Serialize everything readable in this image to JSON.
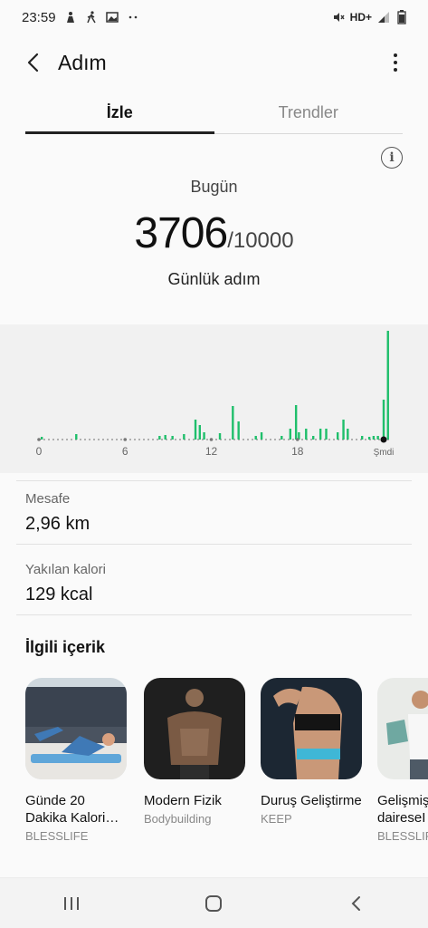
{
  "status_bar": {
    "time": "23:59",
    "network": "HD+"
  },
  "app_bar": {
    "title": "Adım"
  },
  "tabs": [
    {
      "label": "İzle",
      "active": true
    },
    {
      "label": "Trendler",
      "active": false
    }
  ],
  "summary": {
    "day_label": "Bugün",
    "steps": "3706",
    "goal": "/10000",
    "caption": "Günlük adım"
  },
  "chart_data": {
    "type": "bar",
    "x_ticks": [
      "0",
      "6",
      "12",
      "18",
      "Şmdi"
    ],
    "x_range_hours": [
      0,
      24
    ],
    "bars_color": "#1fbf6b",
    "values": [
      [
        0.2,
        3
      ],
      [
        2.6,
        6
      ],
      [
        8.4,
        4
      ],
      [
        8.8,
        5
      ],
      [
        9.3,
        4
      ],
      [
        10.1,
        6
      ],
      [
        10.9,
        22
      ],
      [
        11.2,
        16
      ],
      [
        11.5,
        8
      ],
      [
        12.6,
        7
      ],
      [
        13.5,
        37
      ],
      [
        13.9,
        20
      ],
      [
        15.1,
        4
      ],
      [
        15.5,
        8
      ],
      [
        16.9,
        4
      ],
      [
        17.5,
        12
      ],
      [
        17.9,
        38
      ],
      [
        18.1,
        8
      ],
      [
        18.6,
        12
      ],
      [
        19.1,
        4
      ],
      [
        19.6,
        12
      ],
      [
        20.0,
        12
      ],
      [
        20.8,
        8
      ],
      [
        21.2,
        22
      ],
      [
        21.5,
        12
      ],
      [
        22.5,
        4
      ],
      [
        23.0,
        3
      ],
      [
        23.3,
        4
      ],
      [
        23.6,
        4
      ],
      [
        24.0,
        44
      ],
      [
        24.3,
        120
      ]
    ],
    "value_unit": "steps (relative, unlabeled y-axis)"
  },
  "metrics": [
    {
      "label": "Mesafe",
      "value": "2,96 km"
    },
    {
      "label": "Yakılan kalori",
      "value": "129 kcal"
    }
  ],
  "related": {
    "title": "İlgili içerik",
    "items": [
      {
        "title": "Günde 20 Dakika Kalori…",
        "source": "BLESSLIFE"
      },
      {
        "title": "Modern Fizik",
        "source": "Bodybuilding"
      },
      {
        "title": "Duruş Geliştirme",
        "source": "KEEP"
      },
      {
        "title": "Gelişmiş daireseI",
        "source": "BLESSLIFE"
      }
    ]
  },
  "colors": {
    "accent_green": "#1fbf6b",
    "tab_indicator": "#222222",
    "chart_bg": "#f1f1f1"
  },
  "icons": {
    "status_left": [
      "person-icon",
      "walking-icon",
      "image-icon",
      "more-dots-icon"
    ],
    "status_right": [
      "mute-icon",
      "signal-icon",
      "battery-icon"
    ],
    "nav": [
      "recent-apps-icon",
      "home-icon",
      "back-icon"
    ]
  }
}
